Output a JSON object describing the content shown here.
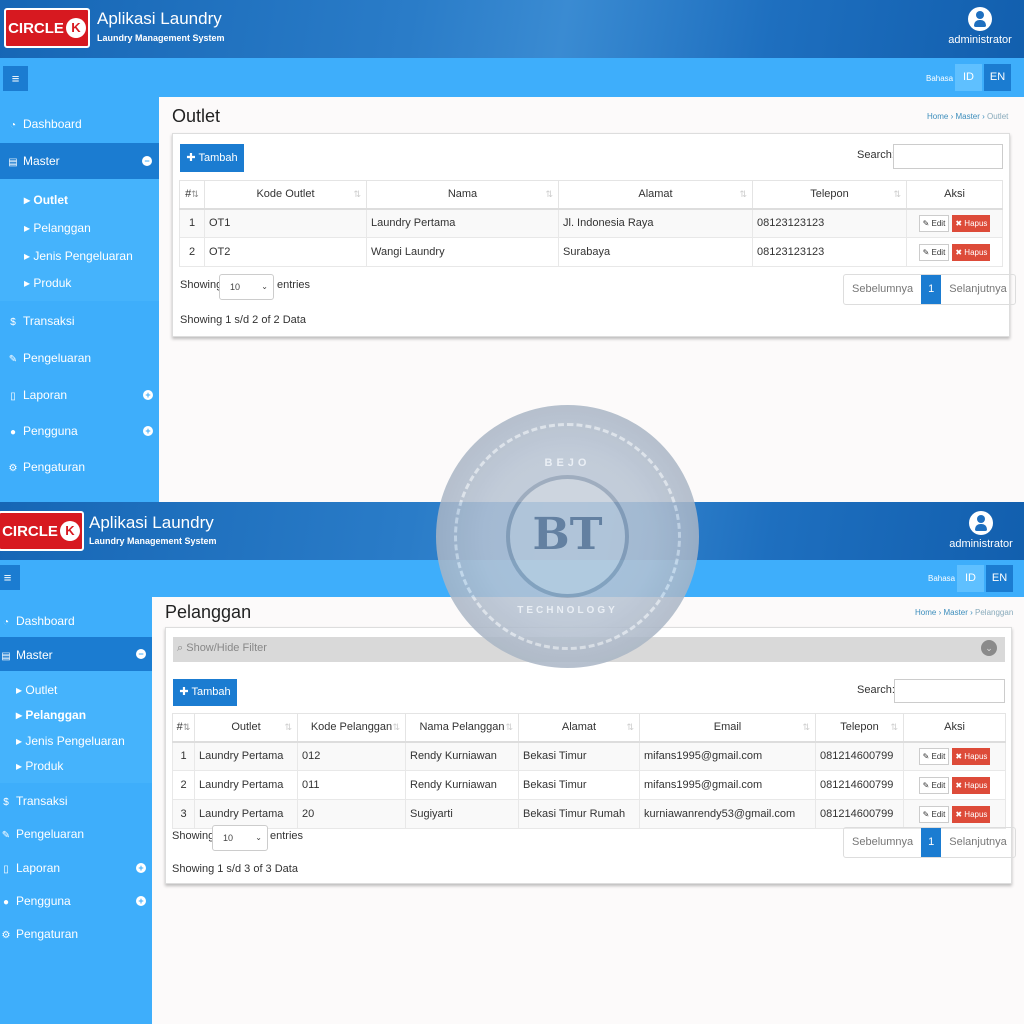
{
  "app": {
    "title": "Aplikasi Laundry",
    "subtitle": "Laundry Management System",
    "user": "administrator",
    "logo_text": "CIRCLE",
    "logo_k": "K"
  },
  "navbar": {
    "bahasa": "Bahasa",
    "lang_id": "ID",
    "lang_en": "EN",
    "menu_icon": "≡"
  },
  "sidebar": {
    "dashboard": "Dashboard",
    "master": "Master",
    "outlet": "Outlet",
    "pelanggan": "Pelanggan",
    "jenis": "Jenis Pengeluaran",
    "produk": "Produk",
    "transaksi": "Transaksi",
    "pengeluaran": "Pengeluaran",
    "laporan": "Laporan",
    "pengguna": "Pengguna",
    "pengaturan": "Pengaturan"
  },
  "common": {
    "tambah": "Tambah",
    "search": "Search:",
    "showing": "Showing",
    "entries": "entries",
    "entries_value": "10",
    "prev": "Sebelumnya",
    "page": "1",
    "next": "Selanjutnya",
    "edit": "Edit",
    "hapus": "Hapus",
    "home": "Home",
    "master": "Master"
  },
  "outlet_page": {
    "title": "Outlet",
    "crumb": "Outlet",
    "headers": [
      "#",
      "Kode Outlet",
      "Nama",
      "Alamat",
      "Telepon",
      "Aksi"
    ],
    "rows": [
      [
        "1",
        "OT1",
        "Laundry Pertama",
        "Jl. Indonesia Raya",
        "08123123123"
      ],
      [
        "2",
        "OT2",
        "Wangi Laundry",
        "Surabaya",
        "08123123123"
      ]
    ],
    "info": "Showing 1 s/d 2 of 2 Data"
  },
  "pelanggan_page": {
    "title": "Pelanggan",
    "crumb": "Pelanggan",
    "filter": "Show/Hide Filter",
    "headers": [
      "#",
      "Outlet",
      "Kode Pelanggan",
      "Nama Pelanggan",
      "Alamat",
      "Email",
      "Telepon",
      "Aksi"
    ],
    "rows": [
      [
        "1",
        "Laundry Pertama",
        "012",
        "Rendy Kurniawan",
        "Bekasi Timur",
        "mifans1995@gmail.com",
        "081214600799"
      ],
      [
        "2",
        "Laundry Pertama",
        "011",
        "Rendy Kurniawan",
        "Bekasi Timur",
        "mifans1995@gmail.com",
        "081214600799"
      ],
      [
        "3",
        "Laundry Pertama",
        "20",
        "Sugiyarti",
        "Bekasi Timur Rumah",
        "kurniawanrendy53@gmail.com",
        "081214600799"
      ]
    ],
    "info": "Showing 1 s/d 3 of 3 Data"
  },
  "watermark": {
    "top": "BEJO",
    "mark": "BT",
    "bottom": "TECHNOLOGY"
  }
}
